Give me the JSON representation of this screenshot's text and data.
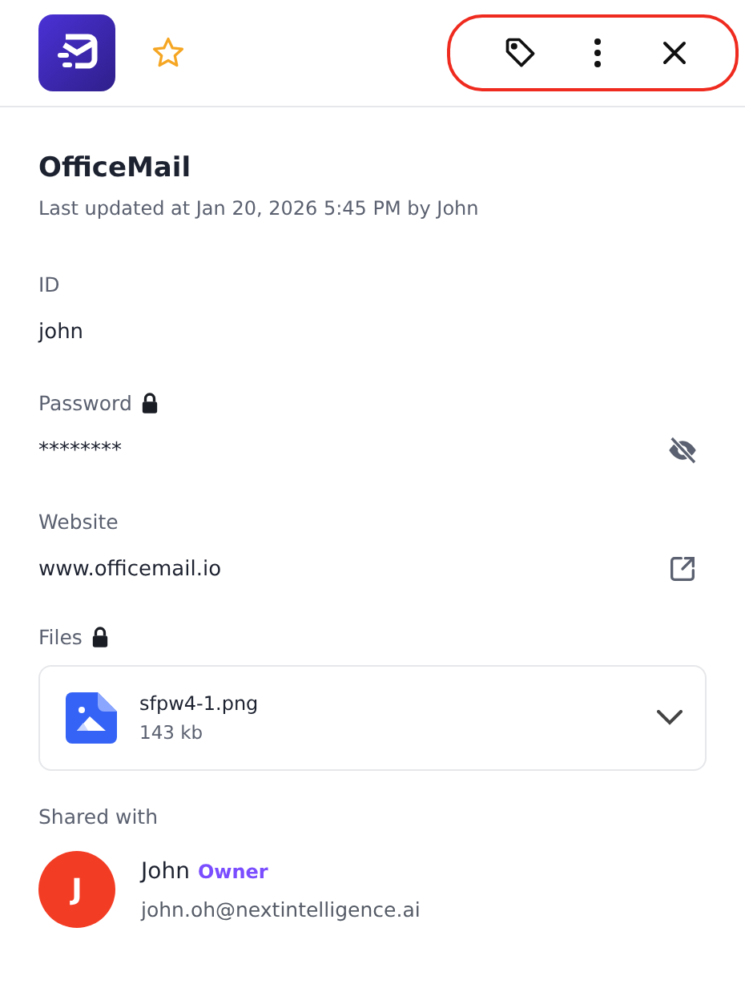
{
  "header": {
    "starred": false,
    "actions_highlighted": true
  },
  "title": "OfficeMail",
  "subtitle": "Last updated at Jan 20, 2026 5:45 PM by John",
  "fields": [
    {
      "kind": "text",
      "label": "ID",
      "locked": false,
      "value": "john"
    },
    {
      "kind": "password",
      "label": "Password",
      "locked": true,
      "value": "********"
    },
    {
      "kind": "link",
      "label": "Website",
      "locked": false,
      "value": "www.officemail.io"
    }
  ],
  "files": {
    "label": "Files",
    "locked": true,
    "items": [
      {
        "name": "sfpw4-1.png",
        "size": "143 kb",
        "expanded": false
      }
    ]
  },
  "shared": {
    "label": "Shared with",
    "people": [
      {
        "initial": "J",
        "name": "John",
        "role": "Owner",
        "email": "john.oh@nextintelligence.ai",
        "color": "#f33c24"
      }
    ]
  }
}
